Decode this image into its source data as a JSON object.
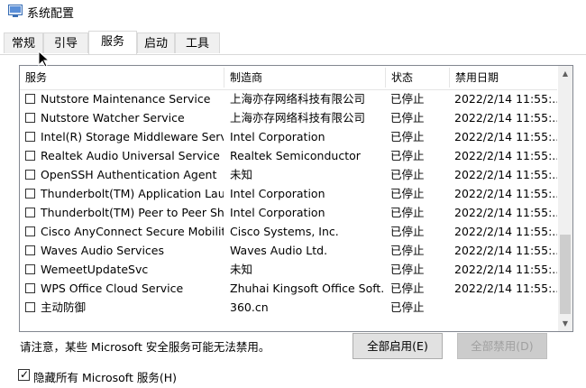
{
  "window": {
    "title": "系统配置"
  },
  "tabs": [
    {
      "label": "常规"
    },
    {
      "label": "引导"
    },
    {
      "label": "服务"
    },
    {
      "label": "启动"
    },
    {
      "label": "工具"
    }
  ],
  "active_tab": "服务",
  "table": {
    "columns": {
      "service": "服务",
      "maker": "制造商",
      "status": "状态",
      "disabled_date": "禁用日期"
    },
    "rows": [
      {
        "name": "Nutstore Maintenance Service",
        "maker": "上海亦存网络科技有限公司",
        "status": "已停止",
        "date": "2022/2/14 11:55:..."
      },
      {
        "name": "Nutstore Watcher Service",
        "maker": "上海亦存网络科技有限公司",
        "status": "已停止",
        "date": "2022/2/14 11:55:..."
      },
      {
        "name": "Intel(R) Storage Middleware Serv...",
        "maker": "Intel Corporation",
        "status": "已停止",
        "date": "2022/2/14 11:55:..."
      },
      {
        "name": "Realtek Audio Universal Service",
        "maker": "Realtek Semiconductor",
        "status": "已停止",
        "date": "2022/2/14 11:55:..."
      },
      {
        "name": "OpenSSH Authentication Agent",
        "maker": "未知",
        "status": "已停止",
        "date": "2022/2/14 11:55:..."
      },
      {
        "name": "Thunderbolt(TM) Application Lau...",
        "maker": "Intel Corporation",
        "status": "已停止",
        "date": "2022/2/14 11:55:..."
      },
      {
        "name": "Thunderbolt(TM) Peer to Peer Sh...",
        "maker": "Intel Corporation",
        "status": "已停止",
        "date": "2022/2/14 11:55:..."
      },
      {
        "name": "Cisco AnyConnect Secure Mobilit...",
        "maker": "Cisco Systems, Inc.",
        "status": "已停止",
        "date": "2022/2/14 11:55:..."
      },
      {
        "name": "Waves Audio Services",
        "maker": "Waves Audio Ltd.",
        "status": "已停止",
        "date": "2022/2/14 11:55:..."
      },
      {
        "name": "WemeetUpdateSvc",
        "maker": "未知",
        "status": "已停止",
        "date": "2022/2/14 11:55:..."
      },
      {
        "name": "WPS Office Cloud Service",
        "maker": "Zhuhai Kingsoft Office Soft...",
        "status": "已停止",
        "date": "2022/2/14 11:55:..."
      },
      {
        "name": "主动防御",
        "maker": "360.cn",
        "status": "已停止",
        "date": ""
      }
    ]
  },
  "note": "请注意，某些 Microsoft 安全服务可能无法禁用。",
  "buttons": {
    "enable_all": "全部启用(E)",
    "disable_all": "全部禁用(D)"
  },
  "hide_microsoft": {
    "label": "隐藏所有 Microsoft 服务(H)",
    "checked": true
  }
}
